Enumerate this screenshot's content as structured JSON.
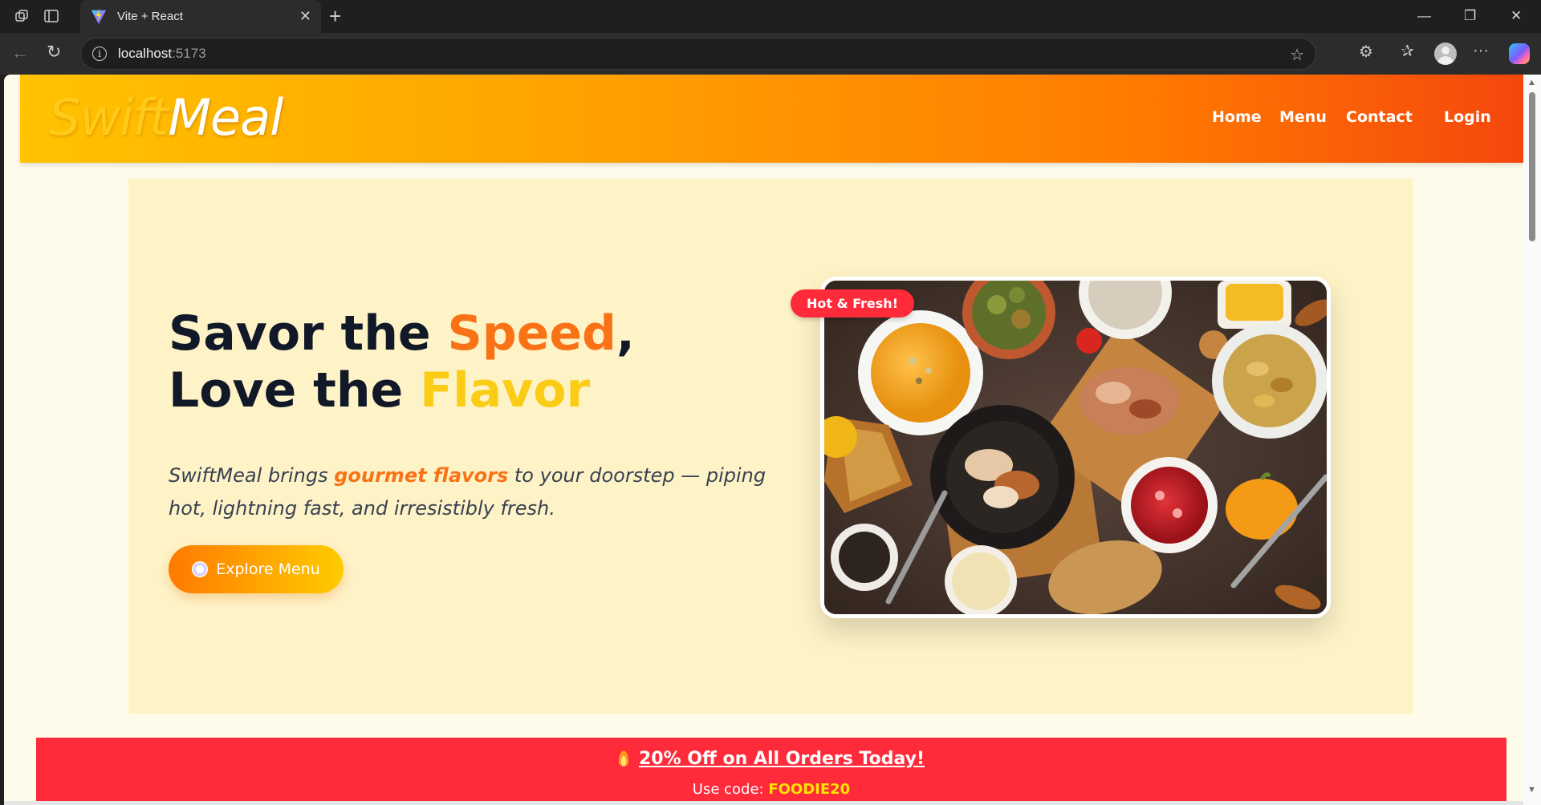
{
  "browser": {
    "tab_title": "Vite + React",
    "url_host": "localhost",
    "url_port": ":5173"
  },
  "navbar": {
    "logo_part1": "Swift",
    "logo_part2": "Meal",
    "links": [
      "Home",
      "Menu",
      "Contact",
      "Login"
    ]
  },
  "hero": {
    "title_line1_a": "Savor the ",
    "title_line1_b": "Speed",
    "title_line1_c": ",",
    "title_line2_a": "Love the ",
    "title_line2_b": "Flavor",
    "desc_a": "SwiftMeal brings ",
    "desc_highlight": "gourmet flavors",
    "desc_b": " to your doorstep — piping hot, lightning fast, and irresistibly fresh.",
    "cta_label": "Explore Menu",
    "badge": "Hot & Fresh!"
  },
  "promo": {
    "title": "20% Off on All Orders Today!",
    "code_label": "Use code: ",
    "code": "FOODIE20"
  },
  "colors": {
    "page_bg": "#fffbeb",
    "hero_bg": "#fef3c7",
    "accent_orange": "#f97316",
    "accent_yellow": "#facc15",
    "promo_red": "#ff2a3a"
  }
}
